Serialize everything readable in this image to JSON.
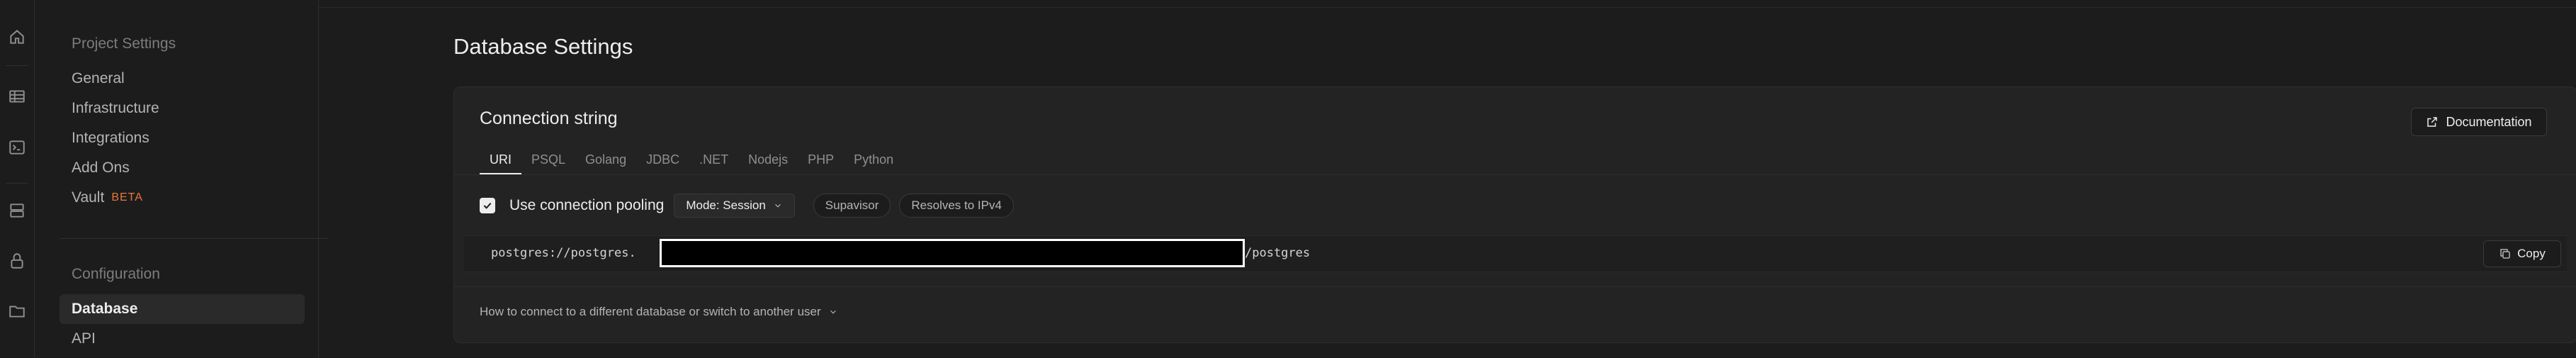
{
  "rail": {
    "icons": [
      "home-icon",
      "table-icon",
      "terminal-icon",
      "database-icon",
      "lock-icon",
      "folder-icon"
    ]
  },
  "sidebar": {
    "project_settings": {
      "title": "Project Settings",
      "items": [
        {
          "label": "General"
        },
        {
          "label": "Infrastructure"
        },
        {
          "label": "Integrations"
        },
        {
          "label": "Add Ons"
        },
        {
          "label": "Vault",
          "badge": "BETA"
        }
      ]
    },
    "configuration": {
      "title": "Configuration",
      "items": [
        {
          "label": "Database",
          "active": true
        },
        {
          "label": "API"
        }
      ]
    }
  },
  "main": {
    "page_title": "Database Settings",
    "card": {
      "title": "Connection string",
      "documentation_label": "Documentation",
      "tabs": [
        {
          "label": "URI",
          "active": true
        },
        {
          "label": "PSQL"
        },
        {
          "label": "Golang"
        },
        {
          "label": "JDBC"
        },
        {
          "label": ".NET"
        },
        {
          "label": "Nodejs"
        },
        {
          "label": "PHP"
        },
        {
          "label": "Python"
        }
      ],
      "pooling": {
        "checked": true,
        "label": "Use connection pooling",
        "mode_label": "Mode: Session",
        "badges": [
          "Supavisor",
          "Resolves to IPv4"
        ]
      },
      "connection": {
        "prefix": "postgres://postgres.",
        "suffix": "/postgres",
        "copy_label": "Copy"
      },
      "help_link": "How to connect to a different database or switch to another user"
    }
  },
  "colors": {
    "background": "#1c1c1c",
    "card": "#232323",
    "border": "#2e2e2e",
    "beta": "#e8773a",
    "text": "#ededed",
    "muted": "#8f8f8f"
  }
}
